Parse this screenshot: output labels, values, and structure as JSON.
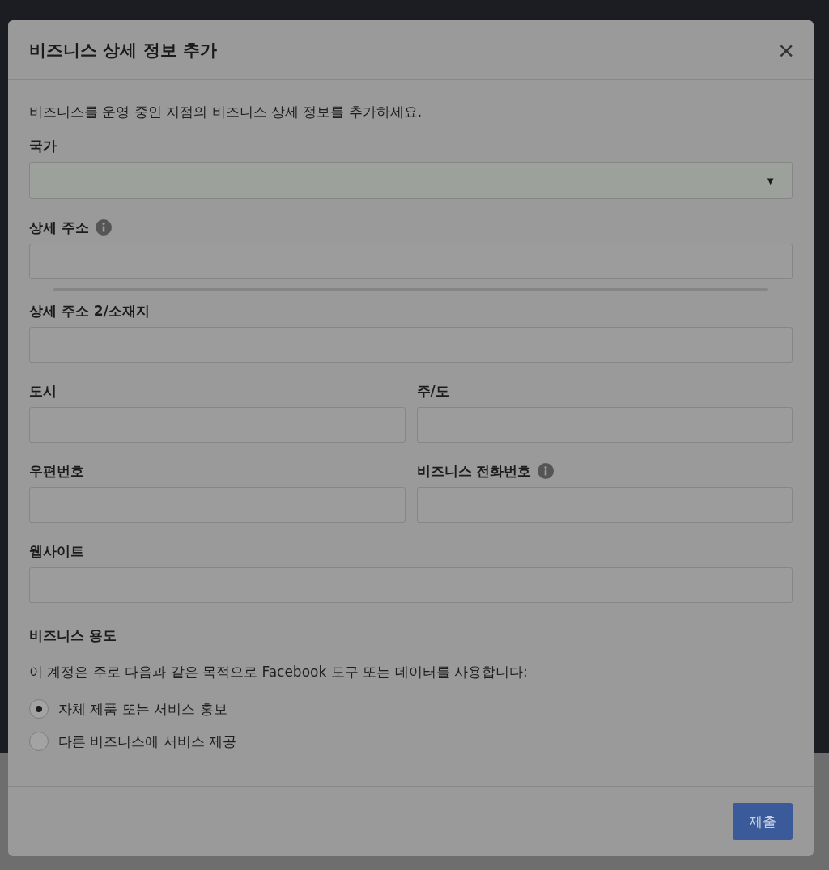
{
  "dialog": {
    "title": "비즈니스 상세 정보 추가",
    "close": "×",
    "description": "비즈니스를 운영 중인 지점의 비즈니스 상세 정보를 추가하세요.",
    "rows": [
      [
        {
          "kind": "select",
          "label": "국가",
          "info": false,
          "caret": "▼"
        }
      ],
      [
        {
          "kind": "text",
          "label": "상세 주소",
          "info": true,
          "suggestions": true
        }
      ],
      [
        {
          "kind": "text",
          "label": "상세 주소 2/소재지",
          "info": false
        }
      ],
      [
        {
          "kind": "text",
          "label": "도시",
          "info": false
        },
        {
          "kind": "text",
          "label": "주/도",
          "info": false
        }
      ],
      [
        {
          "kind": "text",
          "label": "우편번호",
          "info": false
        },
        {
          "kind": "text",
          "label": "비즈니스 전화번호",
          "info": true
        }
      ],
      [
        {
          "kind": "text",
          "label": "웹사이트",
          "info": false
        }
      ]
    ],
    "purpose": {
      "label": "비즈니스 용도",
      "question": "이 계정은 주로 다음과 같은 목적으로 Facebook 도구 또는 데이터를 사용합니다:",
      "options": [
        {
          "label": "자체 제품 또는 서비스 홍보",
          "selected": true
        },
        {
          "label": "다른 비즈니스에 서비스 제공",
          "selected": false
        }
      ]
    },
    "submit": "제출"
  }
}
